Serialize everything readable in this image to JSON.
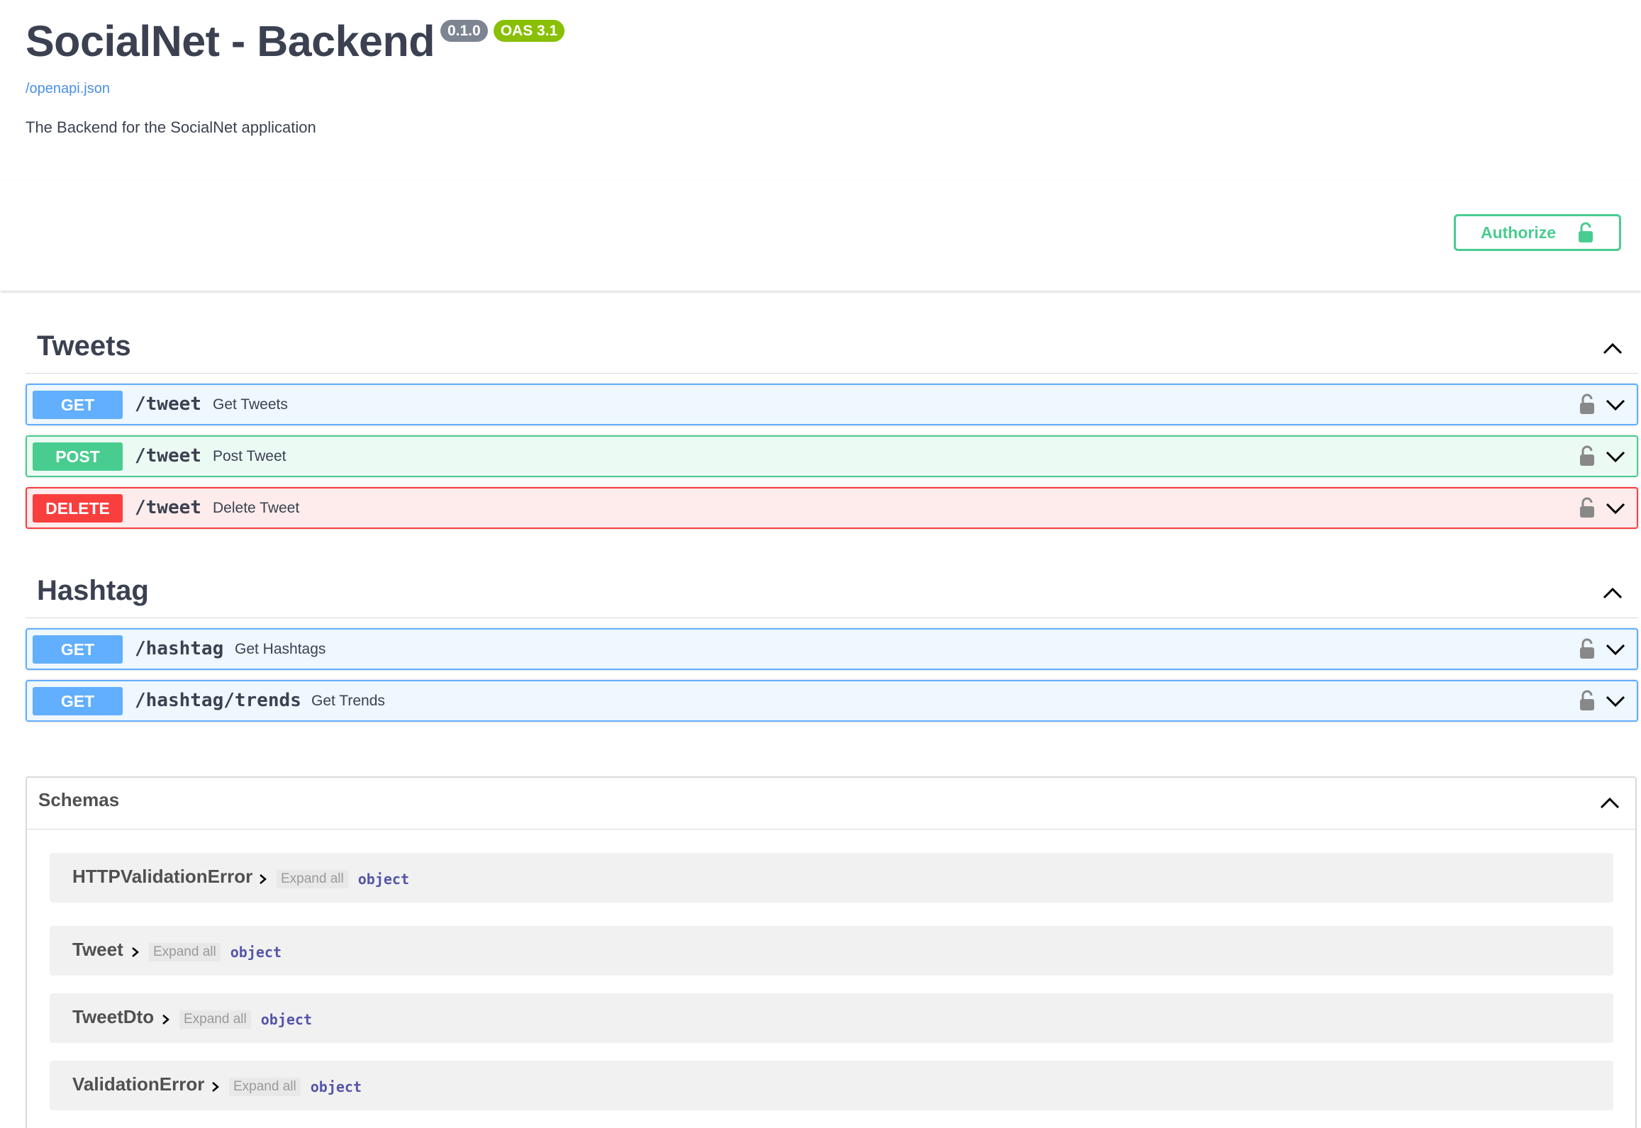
{
  "info": {
    "title": "SocialNet - Backend",
    "version": "0.1.0",
    "oas": "OAS 3.1",
    "spec_link": "/openapi.json",
    "description": "The Backend for the SocialNet application"
  },
  "authorize": {
    "label": "Authorize"
  },
  "tags": [
    {
      "name": "Tweets",
      "operations": [
        {
          "method": "GET",
          "path": "/tweet",
          "summary": "Get Tweets"
        },
        {
          "method": "POST",
          "path": "/tweet",
          "summary": "Post Tweet"
        },
        {
          "method": "DELETE",
          "path": "/tweet",
          "summary": "Delete Tweet"
        }
      ]
    },
    {
      "name": "Hashtag",
      "operations": [
        {
          "method": "GET",
          "path": "/hashtag",
          "summary": "Get Hashtags"
        },
        {
          "method": "GET",
          "path": "/hashtag/trends",
          "summary": "Get Trends"
        }
      ]
    }
  ],
  "schemas": {
    "title": "Schemas",
    "items": [
      {
        "name": "HTTPValidationError",
        "expand": "Expand all",
        "type": "object"
      },
      {
        "name": "Tweet",
        "expand": "Expand all",
        "type": "object"
      },
      {
        "name": "TweetDto",
        "expand": "Expand all",
        "type": "object"
      },
      {
        "name": "ValidationError",
        "expand": "Expand all",
        "type": "object"
      }
    ]
  },
  "colors": {
    "get": "#61affe",
    "post": "#49cc90",
    "delete": "#f93e3e",
    "version_badge": "#7d8492",
    "oas_badge": "#89bf04"
  }
}
